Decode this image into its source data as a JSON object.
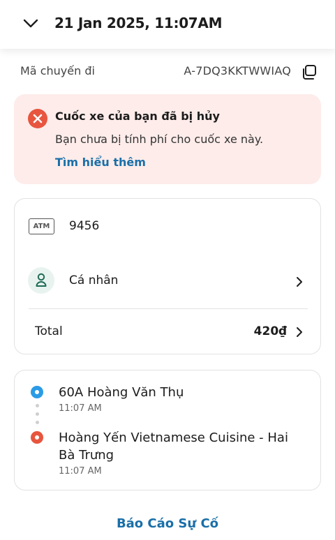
{
  "header": {
    "title": "21 Jan 2025, 11:07AM",
    "back_icon": "chevron-down-icon"
  },
  "trip": {
    "id_label": "Mã chuyến đi",
    "id_value": "A-7DQ3KKTWWIAQ",
    "copy_icon": "copy-icon"
  },
  "cancel_banner": {
    "title": "Cuốc xe của bạn đã bị hủy",
    "description": "Bạn chưa bị tính phí cho cuốc xe này.",
    "link": "Tìm hiểu thêm",
    "icon": "close-circle-icon",
    "background": "#fdecea",
    "icon_color": "#e8553e"
  },
  "payment": {
    "method_badge": "ATM",
    "card_number": "9456",
    "profile_label": "Cá nhân",
    "total_label": "Total",
    "total_value": "420₫"
  },
  "route": {
    "pickup": {
      "name": "60A Hoàng Văn Thụ",
      "time": "11:07 AM",
      "color": "#2b9be6"
    },
    "dropoff": {
      "name": "Hoàng Yến Vietnamese Cuisine - Hai Bà Trưng",
      "time": "11:07 AM",
      "color": "#e8553e"
    }
  },
  "footer": {
    "report_link": "Báo Cáo Sự Cố",
    "link_color": "#1a6fa8"
  }
}
